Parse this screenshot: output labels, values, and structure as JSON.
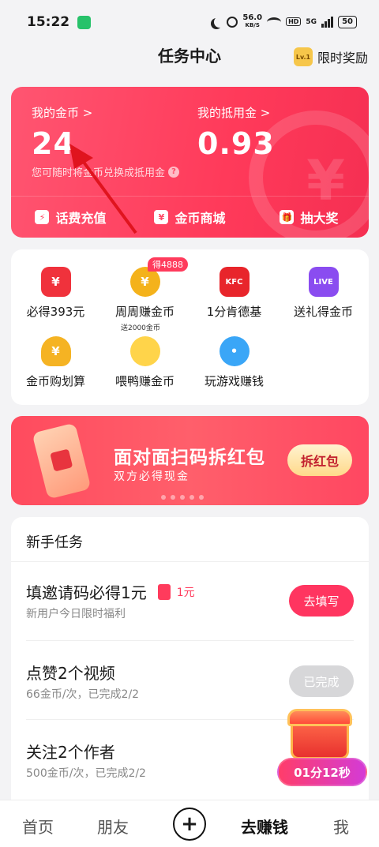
{
  "status_bar": {
    "time": "15:22",
    "speed_top": "56.0",
    "speed_unit": "KB/S",
    "network": "5G",
    "battery": "50"
  },
  "header": {
    "title": "任务中心",
    "badge": "Lv.1",
    "right_label": "限时奖励"
  },
  "coin_card": {
    "my_coins_label": "我的金币 >",
    "my_coins_value": "24",
    "my_deduction_label": "我的抵用金 >",
    "my_deduction_value": "0.93",
    "hint": "您可随时将金币兑换成抵用金",
    "hint_icon": "?",
    "actions": [
      {
        "label": "话费充值",
        "icon": "lightning-icon"
      },
      {
        "label": "金币商城",
        "icon": "ticket-icon"
      },
      {
        "label": "抽大奖",
        "icon": "gift-icon"
      }
    ],
    "watermark": "¥"
  },
  "grid": {
    "items": [
      {
        "label": "必得393元",
        "icon": "red-envelope-icon",
        "glyph": "¥",
        "color": "#f0323c"
      },
      {
        "label": "周周赚金币",
        "icon": "gold-coin-icon",
        "glyph": "¥",
        "color": "#f4b21b",
        "badge": "得4888"
      },
      {
        "label": "1分肯德基",
        "icon": "kfc-icon",
        "glyph": "KFC",
        "color": "#e8252b"
      },
      {
        "label": "送礼得金币",
        "icon": "live-icon",
        "glyph": "LIVE",
        "color": "#8a4cf0"
      },
      {
        "label": "金币购划算",
        "icon": "money-bag-icon",
        "glyph": "¥",
        "color": "#f5b323"
      },
      {
        "label": "喂鸭赚金币",
        "icon": "duck-icon",
        "glyph": "",
        "color": "#ffd44a",
        "badge": "送2000金币"
      },
      {
        "label": "玩游戏赚钱",
        "icon": "game-controller-icon",
        "glyph": "•",
        "color": "#3aa6f7"
      }
    ]
  },
  "banner": {
    "title": "面对面扫码拆红包",
    "subtitle": "双方必得现金",
    "button": "拆红包"
  },
  "tasks": {
    "section_title": "新手任务",
    "items": [
      {
        "title": "填邀请码必得1元",
        "reward": "1元",
        "subtitle": "新用户今日限时福利",
        "button": "去填写",
        "state": "active"
      },
      {
        "title": "点赞2个视频",
        "subtitle": "66金币/次，已完成2/2",
        "button": "已完成",
        "state": "done"
      },
      {
        "title": "关注2个作者",
        "subtitle": "500金币/次，已完成2/2",
        "button": "",
        "state": "done"
      }
    ]
  },
  "floating_chest": {
    "timer": "01分12秒"
  },
  "bottom_nav": {
    "home": "首页",
    "friends": "朋友",
    "plus": "+",
    "earn": "去赚钱",
    "me": "我"
  }
}
